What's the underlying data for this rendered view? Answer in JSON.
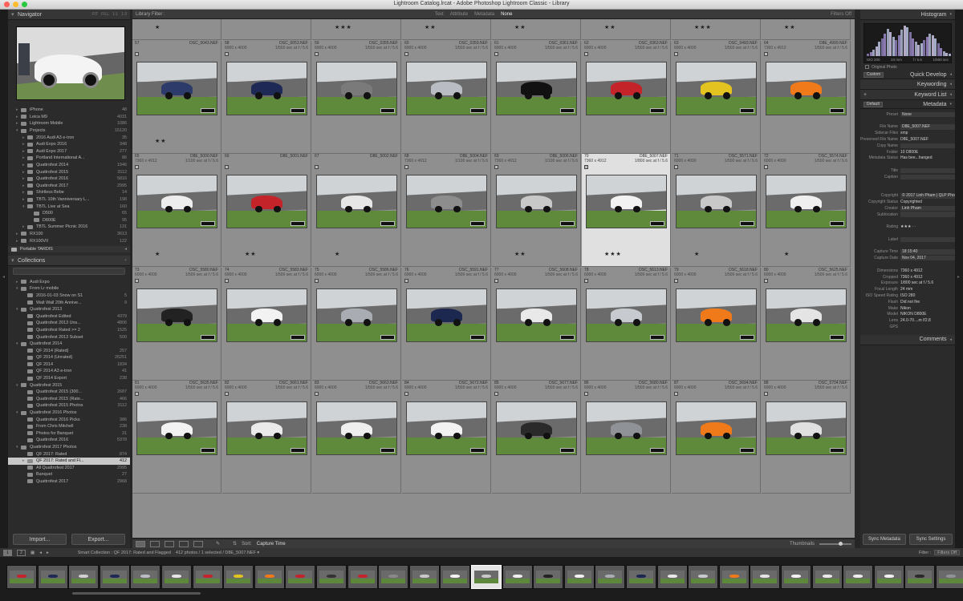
{
  "window": {
    "title": "Lightroom Catalog.lrcat - Adobe Photoshop Lightroom Classic - Library"
  },
  "navigator": {
    "title": "Navigator",
    "zoom": [
      "FIT",
      "FILL",
      "1:1",
      "1:3"
    ]
  },
  "folders": [
    {
      "label": "iPhone",
      "count": "48",
      "level": 1,
      "tri": "▸"
    },
    {
      "label": "Leica M9",
      "count": "4031",
      "level": 1,
      "tri": "▸"
    },
    {
      "label": "Lightroom Mobile",
      "count": "1086",
      "level": 1,
      "tri": "▸"
    },
    {
      "label": "Projects",
      "count": "15120",
      "level": 1,
      "tri": "▾"
    },
    {
      "label": "2016 Audi A3 e-tron",
      "count": "35",
      "level": 2,
      "tri": "▸"
    },
    {
      "label": "Audi Expo 2016",
      "count": "348",
      "level": 2,
      "tri": "▸"
    },
    {
      "label": "Audi Expo 2017",
      "count": "277",
      "level": 2,
      "tri": "▸"
    },
    {
      "label": "Portland International A...",
      "count": "86",
      "level": 2,
      "tri": "▸"
    },
    {
      "label": "Quattrofest 2014",
      "count": "1946",
      "level": 2,
      "tri": "▸"
    },
    {
      "label": "Quattrofest 2015",
      "count": "3112",
      "level": 2,
      "tri": "▸"
    },
    {
      "label": "Quattrofest 2016",
      "count": "5816",
      "level": 2,
      "tri": "▸"
    },
    {
      "label": "Quattrofest 2017",
      "count": "2995",
      "level": 2,
      "tri": "▸"
    },
    {
      "label": "Shirtless Bebe",
      "count": "14",
      "level": 2,
      "tri": "▸"
    },
    {
      "label": "TBTL 10th Vanniversary L...",
      "count": "198",
      "level": 2,
      "tri": "▸"
    },
    {
      "label": "TBTL Live at Sea",
      "count": "160",
      "level": 2,
      "tri": "▾"
    },
    {
      "label": "D500",
      "count": "65",
      "level": 3,
      "tri": ""
    },
    {
      "label": "D800E",
      "count": "95",
      "level": 3,
      "tri": ""
    },
    {
      "label": "TBTL Summer Picnic 2016",
      "count": "131",
      "level": 2,
      "tri": "▸"
    },
    {
      "label": "RX100",
      "count": "3613",
      "level": 1,
      "tri": "▸"
    },
    {
      "label": "RX100VII",
      "count": "122",
      "level": 1,
      "tri": "▸"
    }
  ],
  "drive": {
    "label": "Portable TARDIS"
  },
  "collections_title": "Collections",
  "collections": [
    {
      "label": "Audi Expo",
      "count": "",
      "level": 1,
      "tri": "▸",
      "sel": false
    },
    {
      "label": "From Lr mobile",
      "count": "",
      "level": 1,
      "tri": "▾",
      "sel": false
    },
    {
      "label": "2016-01-03 Snow on S1",
      "count": "5",
      "level": 2,
      "tri": "",
      "sel": false
    },
    {
      "label": "Walt Wall 20th Annive...",
      "count": "9",
      "level": 2,
      "tri": "",
      "sel": false
    },
    {
      "label": "Quattrofest 2013",
      "count": "",
      "level": 1,
      "tri": "▾",
      "sel": false
    },
    {
      "label": "Quattrofest Edited",
      "count": "4379",
      "level": 2,
      "tri": "",
      "sel": false
    },
    {
      "label": "Quattrofest 2013 Uns...",
      "count": "4806",
      "level": 2,
      "tri": "",
      "sel": false
    },
    {
      "label": "Quattrofest Rated >= 2",
      "count": "1525",
      "level": 2,
      "tri": "",
      "sel": false
    },
    {
      "label": "Quattrofest 2013 Subset",
      "count": "500",
      "level": 2,
      "tri": "",
      "sel": false
    },
    {
      "label": "Quattrofest 2014",
      "count": "",
      "level": 1,
      "tri": "▾",
      "sel": false
    },
    {
      "label": "QF 2014 (Rated)",
      "count": "257",
      "level": 2,
      "tri": "",
      "sel": false
    },
    {
      "label": "QF 2014 (Unrated)",
      "count": "26251",
      "level": 2,
      "tri": "",
      "sel": false
    },
    {
      "label": "QF 2014",
      "count": "1834",
      "level": 2,
      "tri": "",
      "sel": false
    },
    {
      "label": "QF 2014 A3 e-tron",
      "count": "41",
      "level": 2,
      "tri": "",
      "sel": false
    },
    {
      "label": "QF 2014 Export",
      "count": "238",
      "level": 2,
      "tri": "",
      "sel": false
    },
    {
      "label": "Quattrofest 2015",
      "count": "",
      "level": 1,
      "tri": "▾",
      "sel": false
    },
    {
      "label": "Quattrofest 2015 (300...",
      "count": "2687",
      "level": 2,
      "tri": "",
      "sel": false
    },
    {
      "label": "Quattrofest 2015 (Rate...",
      "count": "466",
      "level": 2,
      "tri": "",
      "sel": false
    },
    {
      "label": "Quattrofest 2015 Photos",
      "count": "3112",
      "level": 2,
      "tri": "",
      "sel": false
    },
    {
      "label": "Quattrofest 2016 Photos",
      "count": "",
      "level": 1,
      "tri": "▾",
      "sel": false
    },
    {
      "label": "Quattrofest 2016 Picks",
      "count": "386",
      "level": 2,
      "tri": "",
      "sel": false
    },
    {
      "label": "From Chris Mitchell",
      "count": "238",
      "level": 2,
      "tri": "",
      "sel": false
    },
    {
      "label": "Photos for Banquet",
      "count": "31",
      "level": 2,
      "tri": "",
      "sel": false
    },
    {
      "label": "Quattrofest 2016",
      "count": "5378",
      "level": 2,
      "tri": "",
      "sel": false
    },
    {
      "label": "Quattrofest 2017 Photos",
      "count": "",
      "level": 1,
      "tri": "▾",
      "sel": false
    },
    {
      "label": "QF 2017: Rated",
      "count": "874",
      "level": 2,
      "tri": "",
      "sel": false
    },
    {
      "label": "QF 2017: Rated and Fl...",
      "count": "412",
      "level": 2,
      "tri": "▸",
      "sel": true
    },
    {
      "label": "All Quattrofest 2017",
      "count": "2995",
      "level": 2,
      "tri": "",
      "sel": false
    },
    {
      "label": "Banquet",
      "count": "27",
      "level": 2,
      "tri": "",
      "sel": false
    },
    {
      "label": "Quattrofest 2017",
      "count": "2968",
      "level": 2,
      "tri": "",
      "sel": false
    }
  ],
  "left_buttons": {
    "import": "Import...",
    "export": "Export..."
  },
  "filter": {
    "label": "Library Filter :",
    "tabs": [
      "Text",
      "Attribute",
      "Metadata",
      "None"
    ],
    "active": "None",
    "state": "Filters Off"
  },
  "grid": [
    {
      "num": "",
      "file": "",
      "dims": "",
      "exp": "",
      "stars": "★",
      "color": "#9aa3ab",
      "sel": false
    },
    {
      "num": "",
      "file": "",
      "dims": "",
      "exp": "",
      "stars": "",
      "color": "#3a3d44",
      "sel": false
    },
    {
      "num": "",
      "file": "",
      "dims": "",
      "exp": "",
      "stars": "★★★",
      "color": "#e6e6e6",
      "sel": false
    },
    {
      "num": "",
      "file": "",
      "dims": "",
      "exp": "",
      "stars": "★★",
      "color": "#e6e6e6",
      "sel": false
    },
    {
      "num": "",
      "file": "",
      "dims": "",
      "exp": "",
      "stars": "★★",
      "color": "#c9c9c9",
      "sel": false
    },
    {
      "num": "",
      "file": "",
      "dims": "",
      "exp": "",
      "stars": "★★",
      "color": "#d0d0d0",
      "sel": false
    },
    {
      "num": "",
      "file": "",
      "dims": "",
      "exp": "",
      "stars": "★★★",
      "color": "#d22a2a",
      "sel": false
    },
    {
      "num": "",
      "file": "",
      "dims": "",
      "exp": "",
      "stars": "★★",
      "color": "#d22a2a",
      "sel": false
    },
    {
      "num": "57",
      "file": "DSC_0043.NEF",
      "dims": "",
      "exp": "",
      "stars": "★★",
      "color": "#2c3b6a",
      "sel": false
    },
    {
      "num": "58",
      "file": "DSC_0053.NEF",
      "dims": "6000 x 4000",
      "exp": "1/500 sec at f / 5.6",
      "stars": "",
      "color": "#1e2a55",
      "sel": false
    },
    {
      "num": "59",
      "file": "DSC_0355.NEF",
      "dims": "6000 x 4000",
      "exp": "1/500 sec at f / 5.6",
      "stars": "",
      "color": "#7a7a7a",
      "sel": false
    },
    {
      "num": "60",
      "file": "DSC_0359.NEF",
      "dims": "6000 x 4000",
      "exp": "1/500 sec at f / 5.6",
      "stars": "",
      "color": "#b9bcc2",
      "sel": false
    },
    {
      "num": "61",
      "file": "DSC_0361.NEF",
      "dims": "6000 x 4000",
      "exp": "1/500 sec at f / 5.6",
      "stars": "",
      "color": "#111111",
      "sel": false
    },
    {
      "num": "62",
      "file": "DSC_0363.NEF",
      "dims": "6000 x 4000",
      "exp": "1/500 sec at f / 5.6",
      "stars": "",
      "color": "#c4232a",
      "sel": false
    },
    {
      "num": "63",
      "file": "DSC_0493.NEF",
      "dims": "6000 x 4000",
      "exp": "1/500 sec at f / 5.6",
      "stars": "",
      "color": "#e2c320",
      "sel": false
    },
    {
      "num": "64",
      "file": "D8E_4999.NEF",
      "dims": "7360 x 4912",
      "exp": "1/500 sec at f / 5.6",
      "stars": "",
      "color": "#f07a1a",
      "sel": false
    },
    {
      "num": "65",
      "file": "D8E_5000.NEF",
      "dims": "7360 x 4912",
      "exp": "1/100 sec at f / 5.6",
      "stars": "★",
      "color": "#ededed",
      "sel": false
    },
    {
      "num": "66",
      "file": "D8E_5001.NEF",
      "dims": "",
      "exp": "",
      "stars": "★★",
      "color": "#c4232a",
      "sel": false
    },
    {
      "num": "67",
      "file": "D8E_5002.NEF",
      "dims": "",
      "exp": "",
      "stars": "★",
      "color": "#e6e6e6",
      "sel": false
    },
    {
      "num": "68",
      "file": "D8E_5004.NEF",
      "dims": "7360 x 4912",
      "exp": "1/100 sec at f / 5.6",
      "stars": "",
      "color": "#8d8d8d",
      "sel": false
    },
    {
      "num": "69",
      "file": "D8E_5006.NEF",
      "dims": "7360 x 4912",
      "exp": "1/100 sec at f / 5.6",
      "stars": "★★",
      "color": "#c8c8c8",
      "sel": false
    },
    {
      "num": "70",
      "file": "D8E_5007.NEF",
      "dims": "7360 x 4912",
      "exp": "1/800 sec at f / 5.6",
      "stars": "★★★",
      "color": "#f2f2f2",
      "sel": true
    },
    {
      "num": "71",
      "file": "DSC_5571.NEF",
      "dims": "6000 x 4000",
      "exp": "1/500 sec at f / 5.6",
      "stars": "★",
      "color": "#c8c8c8",
      "sel": false
    },
    {
      "num": "72",
      "file": "DSC_5574.NEF",
      "dims": "6000 x 4000",
      "exp": "1/500 sec at f / 5.6",
      "stars": "★",
      "color": "#efefef",
      "sel": false
    },
    {
      "num": "73",
      "file": "DSC_5580.NEF",
      "dims": "6000 x 4000",
      "exp": "1/500 sec at f / 5.6",
      "stars": "",
      "color": "#222222",
      "sel": false
    },
    {
      "num": "74",
      "file": "DSC_5583.NEF",
      "dims": "6000 x 4000",
      "exp": "1/500 sec at f / 5.6",
      "stars": "",
      "color": "#f2f2f2",
      "sel": false
    },
    {
      "num": "75",
      "file": "DSC_5586.NEF",
      "dims": "6000 x 4000",
      "exp": "1/500 sec at f / 5.6",
      "stars": "",
      "color": "#a9adb3",
      "sel": false
    },
    {
      "num": "76",
      "file": "DSC_5591.NEF",
      "dims": "6000 x 4000",
      "exp": "1/500 sec at f / 5.6",
      "stars": "",
      "color": "#1c2850",
      "sel": false
    },
    {
      "num": "77",
      "file": "DSC_5608.NEF",
      "dims": "6000 x 4000",
      "exp": "1/500 sec at f / 5.6",
      "stars": "",
      "color": "#e9e9e9",
      "sel": false
    },
    {
      "num": "78",
      "file": "DSC_5613.NEF",
      "dims": "6000 x 4000",
      "exp": "1/500 sec at f / 5.6",
      "stars": "",
      "color": "#c7cacf",
      "sel": false
    },
    {
      "num": "79",
      "file": "DSC_5618.NEF",
      "dims": "6000 x 4000",
      "exp": "1/500 sec at f / 5.6",
      "stars": "",
      "color": "#f07a1a",
      "sel": false
    },
    {
      "num": "80",
      "file": "DSC_5625.NEF",
      "dims": "6000 x 4000",
      "exp": "1/500 sec at f / 5.6",
      "stars": "",
      "color": "#e4e4e4",
      "sel": false
    },
    {
      "num": "81",
      "file": "DSC_5635.NEF",
      "dims": "6000 x 4000",
      "exp": "1/500 sec at f / 5.6",
      "stars": "",
      "color": "#f2f2f2",
      "sel": false
    },
    {
      "num": "82",
      "file": "DSC_5661.NEF",
      "dims": "6000 x 4000",
      "exp": "1/500 sec at f / 5.6",
      "stars": "",
      "color": "#eaeaea",
      "sel": false
    },
    {
      "num": "83",
      "file": "DSC_5663.NEF",
      "dims": "6000 x 4000",
      "exp": "1/500 sec at f / 5.6",
      "stars": "",
      "color": "#eeeeee",
      "sel": false
    },
    {
      "num": "84",
      "file": "DSC_5672.NEF",
      "dims": "6000 x 4000",
      "exp": "1/500 sec at f / 5.6",
      "stars": "",
      "color": "#f2f2f2",
      "sel": false
    },
    {
      "num": "85",
      "file": "DSC_5677.NEF",
      "dims": "6000 x 4000",
      "exp": "1/500 sec at f / 5.6",
      "stars": "",
      "color": "#2a2a2a",
      "sel": false
    },
    {
      "num": "86",
      "file": "DSC_5680.NEF",
      "dims": "6000 x 4000",
      "exp": "1/500 sec at f / 5.6",
      "stars": "",
      "color": "#8f9398",
      "sel": false
    },
    {
      "num": "87",
      "file": "DSC_5694.NEF",
      "dims": "6000 x 4000",
      "exp": "1/500 sec at f / 5.6",
      "stars": "",
      "color": "#f07a1a",
      "sel": false
    },
    {
      "num": "88",
      "file": "DSC_5704.NEF",
      "dims": "6000 x 4000",
      "exp": "1/500 sec at f / 5.6",
      "stars": "",
      "color": "#e0e0e0",
      "sel": false
    }
  ],
  "toolbar": {
    "sort_label": "Sort:",
    "sort_value": "Capture Time",
    "thumbnails": "Thumbnails"
  },
  "histogram": {
    "title": "Histogram",
    "iso": "ISO 200",
    "focal": "24 mm",
    "aperture": "f / 5.6",
    "shutter": "1/500 sec",
    "original": "Original Photo"
  },
  "right_panels": {
    "quick_develop": "Quick Develop",
    "quick_dd": "Custom",
    "keywording": "Keywording",
    "keyword_list": "Keyword List",
    "metadata": "Metadata",
    "metadata_dd": "Default",
    "comments": "Comments"
  },
  "metadata": [
    {
      "k": "Preset",
      "v": "None",
      "f": true
    },
    {
      "k": "",
      "v": "",
      "f": false
    },
    {
      "k": "File Name",
      "v": "D8E_5007.NEF",
      "f": true
    },
    {
      "k": "Sidecar Files",
      "v": "xmp",
      "f": false
    },
    {
      "k": "Preserved File Name",
      "v": "D8E_5007.NEF",
      "f": false
    },
    {
      "k": "Copy Name",
      "v": "",
      "f": true
    },
    {
      "k": "Folder",
      "v": "10 D800E",
      "f": false
    },
    {
      "k": "Metadata Status",
      "v": "Has bee...hanged",
      "f": false
    },
    {
      "k": "",
      "v": "",
      "f": false
    },
    {
      "k": "Title",
      "v": "",
      "f": true
    },
    {
      "k": "Caption",
      "v": "",
      "f": true
    },
    {
      "k": "",
      "v": "",
      "f": false
    },
    {
      "k": "",
      "v": "",
      "f": false
    },
    {
      "k": "Copyright",
      "v": "© 2017 Linh Pham | QLP Photography",
      "f": true
    },
    {
      "k": "Copyright Status",
      "v": "Copyrighted",
      "f": false
    },
    {
      "k": "Creator",
      "v": "Linh Pham",
      "f": true
    },
    {
      "k": "Sublocation",
      "v": "",
      "f": true
    },
    {
      "k": "",
      "v": "",
      "f": false
    },
    {
      "k": "Rating",
      "v": "★★★ ·  ·",
      "f": false
    },
    {
      "k": "",
      "v": "",
      "f": false
    },
    {
      "k": "Label",
      "v": "",
      "f": true
    },
    {
      "k": "",
      "v": "",
      "f": false
    },
    {
      "k": "Capture Time",
      "v": "18:15:40",
      "f": true
    },
    {
      "k": "Capture Date",
      "v": "Nov 04, 2017",
      "f": true
    },
    {
      "k": "",
      "v": "",
      "f": false
    },
    {
      "k": "Dimensions",
      "v": "7360 x 4912",
      "f": false
    },
    {
      "k": "Cropped",
      "v": "7360 x 4912",
      "f": false
    },
    {
      "k": "Exposure",
      "v": "1/800 sec at f / 5.6",
      "f": false
    },
    {
      "k": "Focal Length",
      "v": "24 mm",
      "f": false
    },
    {
      "k": "ISO Speed Rating",
      "v": "ISO 280",
      "f": false
    },
    {
      "k": "Flash",
      "v": "Did not fire",
      "f": false
    },
    {
      "k": "Make",
      "v": "Nikon",
      "f": false
    },
    {
      "k": "Model",
      "v": "NIKON D800E",
      "f": false
    },
    {
      "k": "Lens",
      "v": "24.0-70....m f/2.8",
      "f": false
    },
    {
      "k": "GPS",
      "v": "",
      "f": false
    }
  ],
  "right_buttons": {
    "sync_metadata": "Sync Metadata",
    "sync_settings": "Sync Settings"
  },
  "filmstrip_bar": {
    "n1": "1",
    "n2": "2",
    "source": "Smart Collection : QF 2017: Rated and Flagged",
    "count": "412 photos / 1 selected / D8E_5007.NEF ▾",
    "filter_label": "Filter :",
    "filter_value": "Filters Off"
  },
  "filmstrip": [
    "#c4232a",
    "#1e2a55",
    "#d0d0d0",
    "#1e2a55",
    "#b9bcc2",
    "#e6e6e6",
    "#c4232a",
    "#e2c320",
    "#f07a1a",
    "#c4232a",
    "#333333",
    "#c4232a",
    "#888888",
    "#c8c8c8",
    "#f2f2f2",
    "#c8c8c8",
    "#efefef",
    "#222222",
    "#f2f2f2",
    "#a9adb3",
    "#1c2850",
    "#e9e9e9",
    "#c7cacf",
    "#f07a1a",
    "#e4e4e4",
    "#f2f2f2",
    "#eaeaea",
    "#eeeeee",
    "#f2f2f2",
    "#2a2a2a",
    "#8f9398"
  ]
}
